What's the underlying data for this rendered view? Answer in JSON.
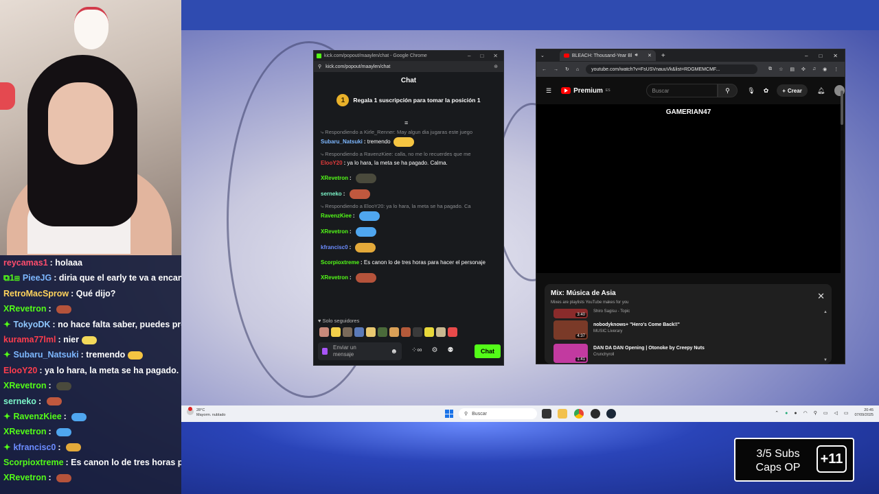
{
  "overlay_chat": [
    {
      "user": "reycamas1",
      "color": "#ff4d6d",
      "badge": "",
      "text": "holaaa",
      "emote": ""
    },
    {
      "user": "PieeJG",
      "color": "#7db7ff",
      "badge": "⧉1⊞",
      "text": "diria que el early te va a encantar",
      "emote": ""
    },
    {
      "user": "RetroMacSprow",
      "color": "#ffd35c",
      "badge": "",
      "text": "Qué dijo?",
      "emote": ""
    },
    {
      "user": "XRevetron",
      "color": "#53fc18",
      "badge": "",
      "text": "",
      "emote": "#b5533b"
    },
    {
      "user": "TokyoDK",
      "color": "#8fc7ff",
      "badge": "✦",
      "text": "no hace falta saber, puedes probar",
      "emote": ""
    },
    {
      "user": "kurama77lml",
      "color": "#ff3d4d",
      "badge": "",
      "text": "nier",
      "emote": "#f3d95a"
    },
    {
      "user": "Subaru_Natsuki",
      "color": "#7db7ff",
      "badge": "✦",
      "text": "tremendo",
      "emote": "#f5c542"
    },
    {
      "user": "ElooY20",
      "color": "#ff3d4d",
      "badge": "",
      "text": "ya lo hara, la meta se ha pagado. Calma.",
      "emote": ""
    },
    {
      "user": "XRevetron",
      "color": "#53fc18",
      "badge": "",
      "text": "",
      "emote": "#4a4a3c"
    },
    {
      "user": "serneko",
      "color": "#7cf6c9",
      "badge": "",
      "text": "",
      "emote": "#c0583e"
    },
    {
      "user": "RavenzKiee",
      "color": "#53fc18",
      "badge": "✦",
      "text": "",
      "emote": "#4fa6ef"
    },
    {
      "user": "XRevetron",
      "color": "#53fc18",
      "badge": "",
      "text": "",
      "emote": "#4fa6ef"
    },
    {
      "user": "kfrancisc0",
      "color": "#6c8cff",
      "badge": "✦",
      "text": "",
      "emote": "#e3a93a"
    },
    {
      "user": "Scorpioxtreme",
      "color": "#53fc18",
      "badge": "",
      "text": "Es canon lo de tres horas para hacer el personaje",
      "emote": ""
    },
    {
      "user": "XRevetron",
      "color": "#53fc18",
      "badge": "",
      "text": "",
      "emote": "#b5533b"
    }
  ],
  "kick": {
    "window_title": "kick.com/popout/maaylen/chat - Google Chrome",
    "url": "kick.com/popout/maaylen/chat",
    "header": "Chat",
    "promo_position": "1",
    "promo_text": "Regala 1 suscripción para tomar la posición 1",
    "messages": [
      {
        "reply": "Respondiendo a Kirle_Renner: May algun dia jugaras este juego",
        "user": "Subaru_Natsuki",
        "color": "#7db7ff",
        "text": "tremendo",
        "emote": "#f5c542"
      },
      {
        "reply": "Respondiendo a RavenzKiee: calla, no me lo recuerdes que me",
        "user": "ElooY20",
        "color": "#e23b3b",
        "text": "ya lo hara, la meta se ha pagado. Calma.",
        "emote": ""
      },
      {
        "reply": "",
        "user": "XRevetron",
        "color": "#53fc18",
        "text": "",
        "emote": "#4a4a3c"
      },
      {
        "reply": "",
        "user": "serneko",
        "color": "#7cf6c9",
        "text": "",
        "emote": "#c0583e"
      },
      {
        "reply": "Respondiendo a ElooY20: ya lo hara, la meta se ha pagado. Ca",
        "user": "RavenzKiee",
        "color": "#53fc18",
        "text": "",
        "emote": "#4fa6ef"
      },
      {
        "reply": "",
        "user": "XRevetron",
        "color": "#53fc18",
        "text": "",
        "emote": "#4fa6ef"
      },
      {
        "reply": "",
        "user": "kfrancisc0",
        "color": "#6c8cff",
        "text": "",
        "emote": "#e3a93a"
      },
      {
        "reply": "",
        "user": "Scorpioxtreme",
        "color": "#53fc18",
        "text": "Es canon lo de tres horas para hacer el personaje",
        "emote": ""
      },
      {
        "reply": "",
        "user": "XRevetron",
        "color": "#53fc18",
        "text": "",
        "emote": "#b5533b"
      }
    ],
    "follow_mode": "Solo seguidores",
    "input_placeholder": "Enviar un mensaje",
    "send_label": "Chat"
  },
  "youtube": {
    "tab_title": "BLEACH: Thousand-Year Bl",
    "url": "youtube.com/watch?v=FsUSVnauuVk&list=RDGMEMCMF...",
    "logo_text": "Premium",
    "logo_region": "ES",
    "search_placeholder": "Buscar",
    "create_label": "Crear",
    "video_title": "GAMERIAN47",
    "mix_title": "Mix: Música de Asia",
    "mix_subtitle": "Mixes are playlists YouTube makes for you",
    "mix_items": [
      {
        "title": "",
        "channel": "Shiro Sagisu - Topic",
        "duration": "3:40",
        "thumb": "#8a2b2b"
      },
      {
        "title": "nobodyknows+ \"Hero's Come Back!!\"",
        "channel": "MUSIC Liverary",
        "duration": "4:37",
        "thumb": "#7a3a28"
      },
      {
        "title": "DAN DA DAN Opening | Otonoke by Creepy Nuts",
        "channel": "Crunchyroll",
        "duration": "1:41",
        "thumb": "#c23aa0"
      }
    ]
  },
  "taskbar": {
    "weather_temp": "28°C",
    "weather_desc": "Mayorm. nublado",
    "search_placeholder": "Buscar",
    "time": "20:45",
    "date": "07/09/2025"
  },
  "subs_goal": {
    "line1": "3/5 Subs",
    "line2": "Caps OP",
    "badge": "+11"
  }
}
